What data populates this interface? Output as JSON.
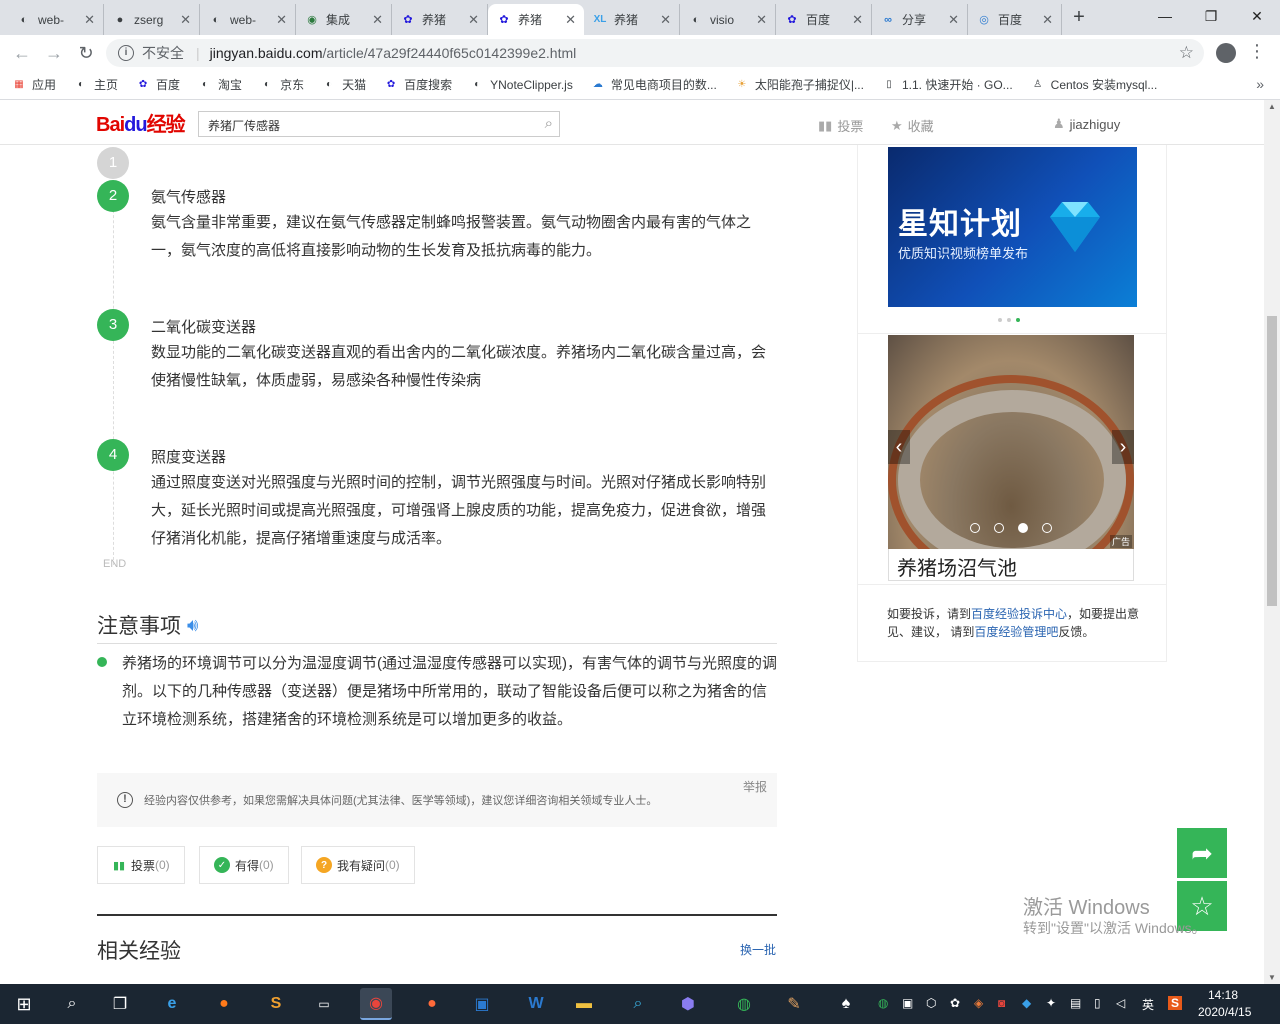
{
  "browser": {
    "tabs": [
      {
        "title": "web-",
        "icon": "globe"
      },
      {
        "title": "zserg",
        "icon": "github"
      },
      {
        "title": "web-",
        "icon": "globe"
      },
      {
        "title": "集成",
        "icon": "edge"
      },
      {
        "title": "养猪",
        "icon": "baidu-paw"
      },
      {
        "title": "养猪",
        "icon": "baidu-paw"
      },
      {
        "title": "养猪",
        "icon": "xl"
      },
      {
        "title": "visio",
        "icon": "globe"
      },
      {
        "title": "百度",
        "icon": "baidu-paw"
      },
      {
        "title": "分享",
        "icon": "share"
      },
      {
        "title": "百度",
        "icon": "baidu-circle"
      }
    ],
    "active_tab": 5,
    "insecure_label": "不安全",
    "url_host": "jingyan.baidu.com",
    "url_path": "/article/47a29f24440f65c0142399e2.html"
  },
  "bookmarks": [
    {
      "label": "应用",
      "icon": "apps-grid"
    },
    {
      "label": "主页",
      "icon": "globe"
    },
    {
      "label": "百度",
      "icon": "baidu-paw"
    },
    {
      "label": "淘宝",
      "icon": "globe"
    },
    {
      "label": "京东",
      "icon": "globe"
    },
    {
      "label": "天猫",
      "icon": "globe"
    },
    {
      "label": "百度搜索",
      "icon": "baidu-paw"
    },
    {
      "label": "YNoteClipper.js",
      "icon": "globe"
    },
    {
      "label": "常见电商项目的数...",
      "icon": "cloud"
    },
    {
      "label": "太阳能孢子捕捉仪|...",
      "icon": "sun"
    },
    {
      "label": "1.1. 快速开始 · GO...",
      "icon": "book"
    },
    {
      "label": "Centos 安装mysql...",
      "icon": "person"
    }
  ],
  "header": {
    "logo_bai": "Bai",
    "logo_du": "du",
    "logo_jy": "经验",
    "search_value": "养猪厂传感器",
    "vote_label": "投票",
    "collect_label": "收藏",
    "username": "jiazhiguy"
  },
  "steps": [
    {
      "num": "1"
    },
    {
      "num": "2",
      "title": "氨气传感器",
      "body": "氨气含量非常重要，建议在氨气传感器定制蜂鸣报警装置。氨气动物圈舍内最有害的气体之一，氨气浓度的高低将直接影响动物的生长发育及抵抗病毒的能力。"
    },
    {
      "num": "3",
      "title": "二氧化碳变送器",
      "body": "数显功能的二氧化碳变送器直观的看出舍内的二氧化碳浓度。养猪场内二氧化碳含量过高，会使猪慢性缺氧，体质虚弱，易感染各种慢性传染病"
    },
    {
      "num": "4",
      "title": "照度变送器",
      "body": "通过照度变送对光照强度与光照时间的控制，调节光照强度与时间。光照对仔猪成长影响特别大，延长光照时间或提高光照强度，可增强肾上腺皮质的功能，提高免疫力，促进食欲，增强仔猪消化机能，提高仔猪增重速度与成活率。"
    }
  ],
  "end_label": "END",
  "notes": {
    "title": "注意事项",
    "body": "养猪场的环境调节可以分为温湿度调节(通过温湿度传感器可以实现)，有害气体的调节与光照度的调剂。以下的几种传感器（变送器）便是猪场中所常用的，联动了智能设备后便可以称之为猪舍的信立环境检测系统，搭建猪舍的环境检测系统是可以增加更多的收益。"
  },
  "disclaimer": {
    "text": "经验内容仅供参考，如果您需解决具体问题(尤其法律、医学等领域)，建议您详细咨询相关领域专业人士。",
    "report_label": "举报"
  },
  "actions": [
    {
      "label": "投票",
      "count": "(0)"
    },
    {
      "label": "有得",
      "count": "(0)"
    },
    {
      "label": "我有疑问",
      "count": "(0)"
    }
  ],
  "related": {
    "title": "相关经验",
    "refresh_label": "换一批"
  },
  "sidebar": {
    "banner_title": "星知计划",
    "banner_subtitle": "优质知识视频榜单发布",
    "ad_tag": "广告",
    "ad_label": "养猪场沼气池",
    "note_part1": "如要投诉，请到",
    "note_link1": "百度经验投诉中心",
    "note_part2": "，如要提出意见、建议， 请到",
    "note_link2": "百度经验管理吧",
    "note_part3": "反馈。"
  },
  "watermark": {
    "line1": "激活 Windows",
    "line2": "转到\"设置\"以激活 Windows。"
  },
  "taskbar": {
    "ime_label": "英",
    "time": "14:18",
    "date": "2020/4/15"
  },
  "colors": {
    "accent_green": "#35b558",
    "link_blue": "#2a64b1",
    "baidu_red": "#e10601",
    "baidu_blue": "#2319dc"
  }
}
